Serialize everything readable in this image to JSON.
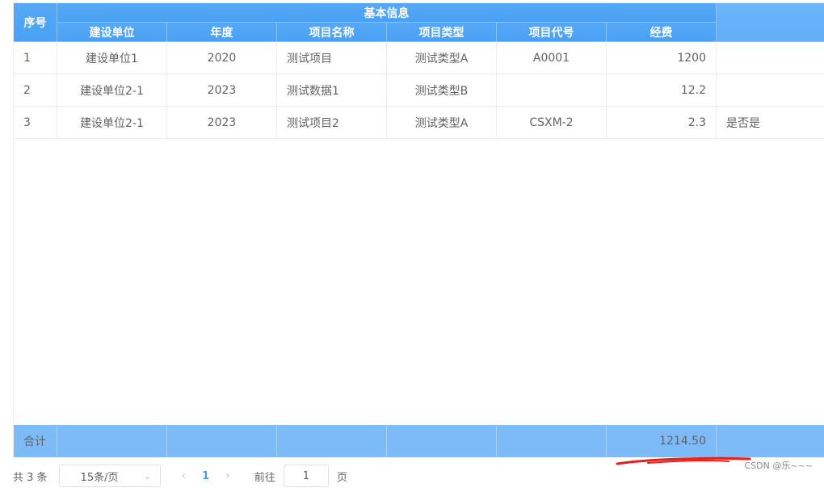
{
  "header": {
    "seq": "序号",
    "group": "基本信息",
    "columns": [
      "建设单位",
      "年度",
      "项目名称",
      "项目类型",
      "项目代号",
      "经费"
    ]
  },
  "rows": [
    {
      "seq": "1",
      "unit": "建设单位1",
      "year": "2020",
      "name": "测试项目",
      "type": "测试类型A",
      "code": "A0001",
      "fund": "1200",
      "extra": ""
    },
    {
      "seq": "2",
      "unit": "建设单位2-1",
      "year": "2023",
      "name": "测试数据1",
      "type": "测试类型B",
      "code": "",
      "fund": "12.2",
      "extra": ""
    },
    {
      "seq": "3",
      "unit": "建设单位2-1",
      "year": "2023",
      "name": "测试项目2",
      "type": "测试类型A",
      "code": "CSXM-2",
      "fund": "2.3",
      "extra": "是否是"
    }
  ],
  "footer": {
    "label": "合计",
    "fund_total": "1214.50"
  },
  "pagination": {
    "total": "共 3 条",
    "page_size": "15条/页",
    "prev": "‹",
    "current": "1",
    "next": "›",
    "goto_label": "前往",
    "goto_value": "1",
    "goto_unit": "页"
  },
  "watermark": "CSDN @乐~~~"
}
